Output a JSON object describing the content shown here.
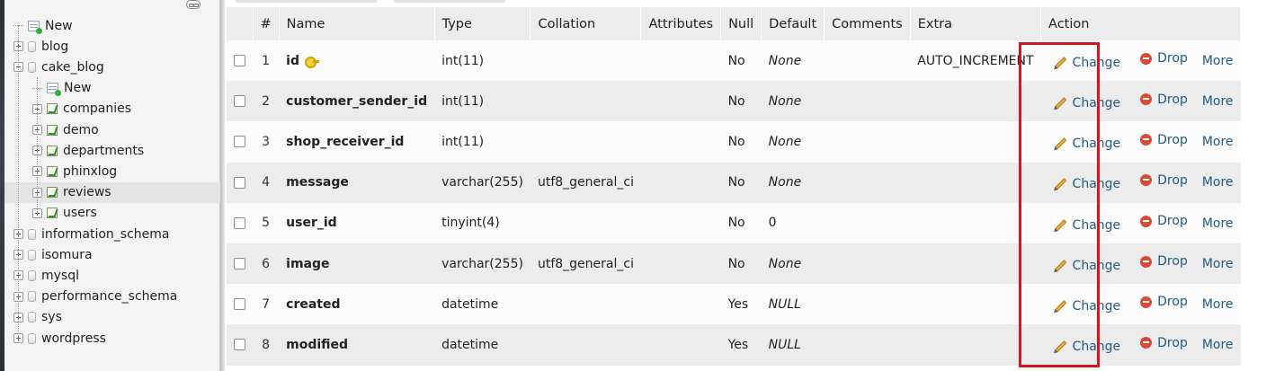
{
  "navigation": {
    "items": [
      {
        "label": "New",
        "kind": "new",
        "level": 0
      },
      {
        "label": "blog",
        "kind": "db",
        "level": 0,
        "expander": "plus"
      },
      {
        "label": "cake_blog",
        "kind": "db",
        "level": 0,
        "expander": "minus"
      },
      {
        "label": "New",
        "kind": "new",
        "level": 1
      },
      {
        "label": "companies",
        "kind": "table",
        "level": 1,
        "expander": "plus"
      },
      {
        "label": "demo",
        "kind": "table",
        "level": 1,
        "expander": "plus"
      },
      {
        "label": "departments",
        "kind": "table",
        "level": 1,
        "expander": "plus"
      },
      {
        "label": "phinxlog",
        "kind": "table",
        "level": 1,
        "expander": "plus"
      },
      {
        "label": "reviews",
        "kind": "table",
        "level": 1,
        "expander": "plus",
        "selected": true
      },
      {
        "label": "users",
        "kind": "table",
        "level": 1,
        "expander": "plus"
      },
      {
        "label": "information_schema",
        "kind": "db",
        "level": 0,
        "expander": "plus"
      },
      {
        "label": "isomura",
        "kind": "db",
        "level": 0,
        "expander": "plus"
      },
      {
        "label": "mysql",
        "kind": "db",
        "level": 0,
        "expander": "plus"
      },
      {
        "label": "performance_schema",
        "kind": "db",
        "level": 0,
        "expander": "plus"
      },
      {
        "label": "sys",
        "kind": "db",
        "level": 0,
        "expander": "plus"
      },
      {
        "label": "wordpress",
        "kind": "db",
        "level": 0,
        "expander": "plus"
      }
    ]
  },
  "structure": {
    "headers": {
      "num": "#",
      "name": "Name",
      "type": "Type",
      "collation": "Collation",
      "attributes": "Attributes",
      "null": "Null",
      "default": "Default",
      "comments": "Comments",
      "extra": "Extra",
      "action": "Action"
    },
    "rows": [
      {
        "num": "1",
        "name": "id",
        "primary": true,
        "type": "int(11)",
        "collation": "",
        "attributes": "",
        "null": "No",
        "default": "None",
        "comments": "",
        "extra": "AUTO_INCREMENT"
      },
      {
        "num": "2",
        "name": "customer_sender_id",
        "type": "int(11)",
        "collation": "",
        "attributes": "",
        "null": "No",
        "default": "None",
        "comments": "",
        "extra": ""
      },
      {
        "num": "3",
        "name": "shop_receiver_id",
        "type": "int(11)",
        "collation": "",
        "attributes": "",
        "null": "No",
        "default": "None",
        "comments": "",
        "extra": ""
      },
      {
        "num": "4",
        "name": "message",
        "type": "varchar(255)",
        "collation": "utf8_general_ci",
        "attributes": "",
        "null": "No",
        "default": "None",
        "comments": "",
        "extra": ""
      },
      {
        "num": "5",
        "name": "user_id",
        "type": "tinyint(4)",
        "collation": "",
        "attributes": "",
        "null": "No",
        "default": "0",
        "defaultPlain": true,
        "comments": "",
        "extra": ""
      },
      {
        "num": "6",
        "name": "image",
        "type": "varchar(255)",
        "collation": "utf8_general_ci",
        "attributes": "",
        "null": "No",
        "default": "None",
        "comments": "",
        "extra": ""
      },
      {
        "num": "7",
        "name": "created",
        "type": "datetime",
        "collation": "",
        "attributes": "",
        "null": "Yes",
        "default": "NULL",
        "comments": "",
        "extra": ""
      },
      {
        "num": "8",
        "name": "modified",
        "type": "datetime",
        "collation": "",
        "attributes": "",
        "null": "Yes",
        "default": "NULL",
        "comments": "",
        "extra": ""
      }
    ],
    "actions": {
      "change": "Change",
      "drop": "Drop",
      "more": "More"
    }
  },
  "colors": {
    "link": "#235a81",
    "highlight": "#d8141e",
    "drop": "#d94a3a"
  }
}
